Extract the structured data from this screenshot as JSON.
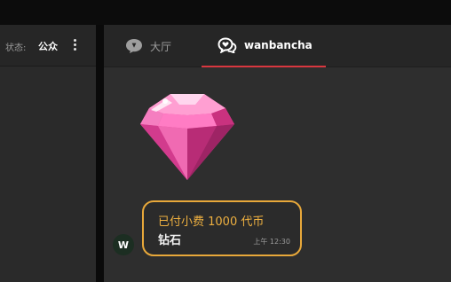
{
  "left_panel": {
    "status_label": "状态:",
    "status_value": "公众"
  },
  "tabs": [
    {
      "label": "大厅",
      "icon": "chat-bubble-icon",
      "active": false
    },
    {
      "label": "wanbancha",
      "icon": "heart-chat-icon",
      "active": true
    }
  ],
  "message": {
    "sticker": "diamond-icon",
    "avatar_letter": "W",
    "tip_text": "已付小费 1000 代币",
    "item_name": "钻石",
    "time": "上午 12:30"
  },
  "colors": {
    "accent_gold": "#e8a83a",
    "active_tab_underline": "#d9373f",
    "gem_pink": "#e8439a"
  }
}
